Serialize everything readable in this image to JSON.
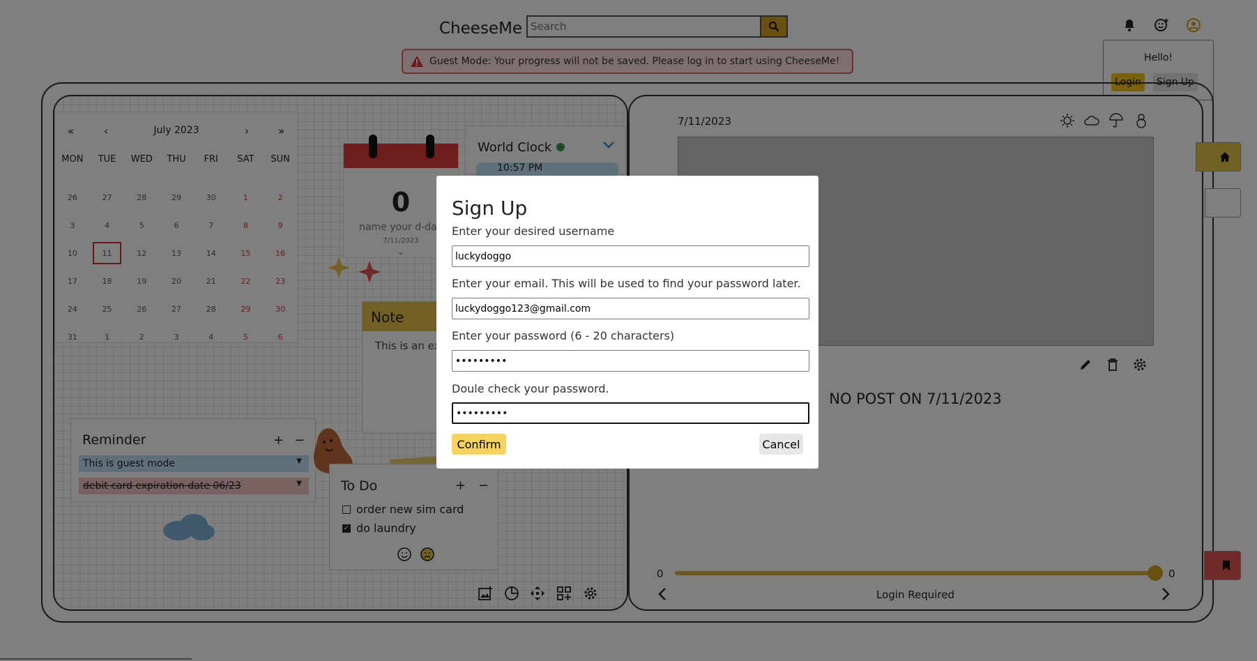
{
  "header": {
    "brand": "CheeseMe",
    "search_placeholder": "Search"
  },
  "guest_banner": {
    "text": "Guest Mode: Your progress will not be saved. Please log in to start using CheeseMe!"
  },
  "user_popover": {
    "greeting": "Hello!",
    "login_label": "Login",
    "signup_label": "Sign Up"
  },
  "calendar": {
    "title": "July 2023",
    "nav": [
      "«",
      "‹",
      "›",
      "»"
    ],
    "weekdays": [
      "MON",
      "TUE",
      "WED",
      "THU",
      "FRI",
      "SAT",
      "SUN"
    ],
    "days": [
      "26",
      "27",
      "28",
      "29",
      "30",
      "1",
      "2",
      "3",
      "4",
      "5",
      "6",
      "7",
      "8",
      "9",
      "10",
      "11",
      "12",
      "13",
      "14",
      "15",
      "16",
      "17",
      "18",
      "19",
      "20",
      "21",
      "22",
      "23",
      "24",
      "25",
      "26",
      "27",
      "28",
      "29",
      "30",
      "31",
      "1",
      "2",
      "3",
      "4",
      "5",
      "6"
    ],
    "today": "11"
  },
  "dday": {
    "number": "0",
    "name": "name your d-day",
    "date": "7/11/2023"
  },
  "world_clock": {
    "title": "World Clock",
    "time": "10:57 PM"
  },
  "note": {
    "title": "Note",
    "body": "This is an example note"
  },
  "reminder": {
    "title": "Reminder",
    "add": "+",
    "remove": "−",
    "items": [
      {
        "text": "This is guest mode",
        "color": "#bfe0f5"
      },
      {
        "text": "debit card expiration date 06/23",
        "color": "#f2c4c4"
      }
    ]
  },
  "todo": {
    "title": "To Do",
    "add": "+",
    "remove": "−",
    "items": [
      {
        "text": "order new sim card",
        "checked": false
      },
      {
        "text": "do laundry",
        "checked": true
      }
    ]
  },
  "diary": {
    "date": "7/11/2023",
    "no_post": "NO POST ON 7/11/2023",
    "slider_min": "0",
    "slider_max": "0",
    "footer": "Login Required"
  },
  "modal": {
    "title": "Sign Up",
    "username_label": "Enter your desired username",
    "username_value": "luckydoggo",
    "email_label": "Enter your email. This will be used to find your password later.",
    "email_value": "luckydoggo123@gmail.com",
    "password_label": "Enter your password (6 - 20 characters)",
    "password_value": "•••••••••",
    "confirm_label": "Doule check your password.",
    "confirm_value": "•••••••••",
    "confirm_button": "Confirm",
    "cancel_button": "Cancel"
  },
  "colors": {
    "accent": "#d4a020",
    "danger": "#e03a3a",
    "overlay": "rgba(0,0,0,0.5)"
  }
}
